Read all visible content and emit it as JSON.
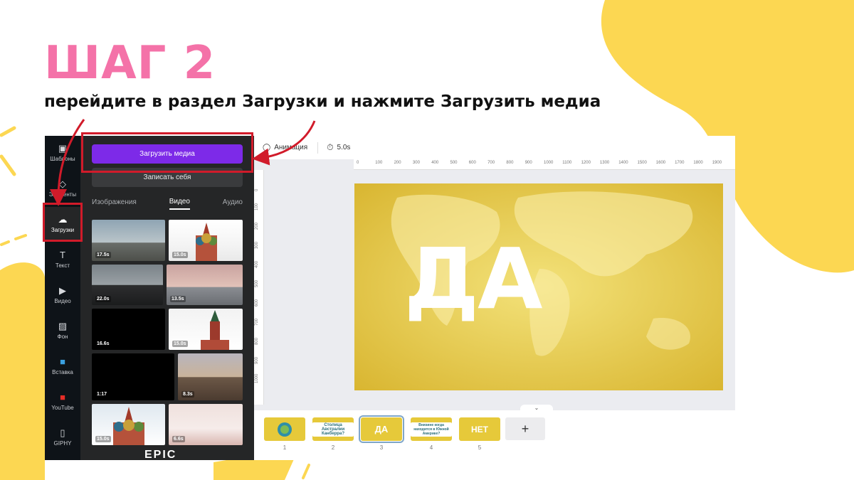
{
  "slide": {
    "step_title": "ШАГ 2",
    "step_subtitle": "перейдите в раздел Загрузки и нажмите Загрузить медиа",
    "colors": {
      "title_pink": "#f472a8",
      "accent_yellow": "#fcd752",
      "highlight_red": "#d11b2a"
    }
  },
  "rail": {
    "items": [
      {
        "label": "Шаблоны",
        "icon": "layout-icon"
      },
      {
        "label": "Элементы",
        "icon": "shapes-icon"
      },
      {
        "label": "Загрузки",
        "icon": "cloud-upload-icon"
      },
      {
        "label": "Текст",
        "icon": "text-icon"
      },
      {
        "label": "Видео",
        "icon": "video-icon"
      },
      {
        "label": "Фон",
        "icon": "background-icon"
      },
      {
        "label": "Вставка",
        "icon": "embed-icon"
      },
      {
        "label": "YouTube",
        "icon": "youtube-icon"
      },
      {
        "label": "GIPHY",
        "icon": "giphy-icon"
      }
    ]
  },
  "panel": {
    "upload_button": "Загрузить медиа",
    "record_button": "Записать себя",
    "tabs": [
      "Изображения",
      "Видео",
      "Аудио"
    ],
    "active_tab": "Видео",
    "videos": [
      {
        "duration": "17.5s"
      },
      {
        "duration": "15.0s"
      },
      {
        "duration": "22.0s"
      },
      {
        "duration": "13.5s"
      },
      {
        "duration": "16.6s"
      },
      {
        "duration": "15.0s"
      },
      {
        "duration": "1:17"
      },
      {
        "duration": "8.3s"
      },
      {
        "duration": "15.0s"
      },
      {
        "duration": "6.6s"
      }
    ],
    "partial_text": "EPIC"
  },
  "toolbar": {
    "animation_label": "Анимация",
    "duration": "5.0s"
  },
  "ruler": {
    "top": [
      "0",
      "100",
      "200",
      "300",
      "400",
      "500",
      "600",
      "700",
      "800",
      "900",
      "1000",
      "1100",
      "1200",
      "1300",
      "1400",
      "1500",
      "1600",
      "1700",
      "1800",
      "1900"
    ],
    "left": [
      "0",
      "100",
      "200",
      "300",
      "400",
      "500",
      "600",
      "700",
      "800",
      "900",
      "1000"
    ]
  },
  "canvas": {
    "word": "ДА"
  },
  "pages": {
    "items": [
      {
        "num": "1",
        "text": ""
      },
      {
        "num": "2",
        "text": "Столица Австралии Канберра?"
      },
      {
        "num": "3",
        "text": "ДА"
      },
      {
        "num": "4",
        "text": "Внизине когда находится в Южной Америке?"
      },
      {
        "num": "5",
        "text": "НЕТ"
      }
    ],
    "selected": "3",
    "add_label": "+"
  }
}
